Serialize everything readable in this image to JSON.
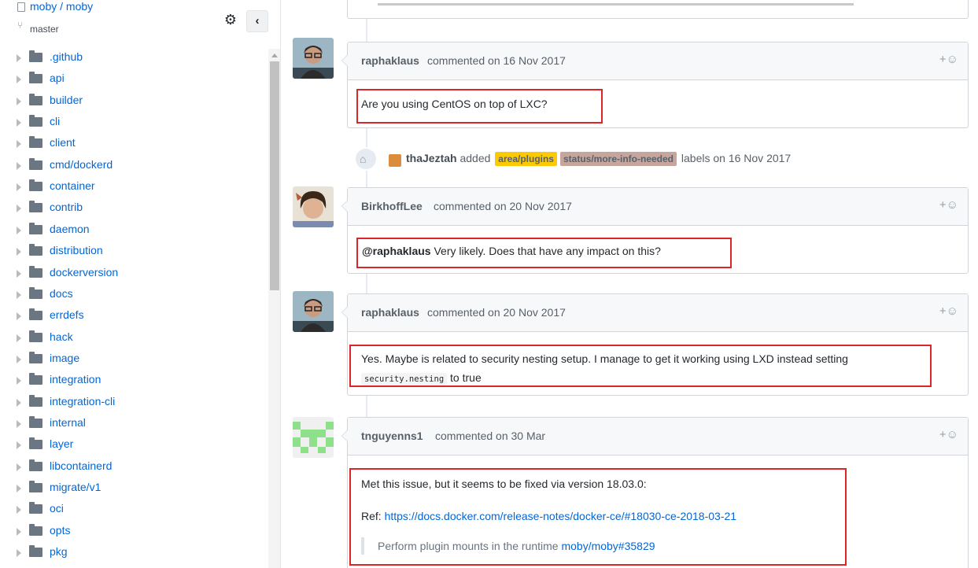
{
  "repo": {
    "name": "moby / moby",
    "branch": "master"
  },
  "sidebar": {
    "items": [
      {
        "label": ".github"
      },
      {
        "label": "api"
      },
      {
        "label": "builder"
      },
      {
        "label": "cli"
      },
      {
        "label": "client"
      },
      {
        "label": "cmd/dockerd"
      },
      {
        "label": "container"
      },
      {
        "label": "contrib"
      },
      {
        "label": "daemon"
      },
      {
        "label": "distribution"
      },
      {
        "label": "dockerversion"
      },
      {
        "label": "docs"
      },
      {
        "label": "errdefs"
      },
      {
        "label": "hack"
      },
      {
        "label": "image"
      },
      {
        "label": "integration"
      },
      {
        "label": "integration-cli"
      },
      {
        "label": "internal"
      },
      {
        "label": "layer"
      },
      {
        "label": "libcontainerd"
      },
      {
        "label": "migrate/v1"
      },
      {
        "label": "oci"
      },
      {
        "label": "opts"
      },
      {
        "label": "pkg"
      }
    ]
  },
  "comments": [
    {
      "author": "raphaklaus",
      "meta": "commented on 16 Nov 2017",
      "body": "Are you using CentOS on top of LXC?"
    },
    {
      "author": "BirkhoffLee",
      "meta": "commented on 20 Nov 2017",
      "mention": "@raphaklaus",
      "body": " Very likely. Does that have any impact on this?"
    },
    {
      "author": "raphaklaus",
      "meta": "commented on 20 Nov 2017",
      "line1": "Yes. Maybe is related to security nesting setup. I manage to get it working using LXD instead setting",
      "code": "security.nesting",
      "line2": " to true"
    },
    {
      "author": "tnguyenns1",
      "meta": "commented on 30 Mar",
      "line1": "Met this issue, but it seems to be fixed via version 18.03.0:",
      "ref_label": "Ref: ",
      "ref_link": "https://docs.docker.com/release-notes/docker-ce/#18030-ce-2018-03-21",
      "quote_text": "Perform plugin mounts in the runtime ",
      "quote_link": "moby/moby#35829"
    }
  ],
  "event": {
    "actor": "thaJeztah",
    "action": " added ",
    "labels": [
      {
        "name": "area/plugins",
        "color": "#fbca04",
        "text_color": "#24292e"
      },
      {
        "name": "status/more-info-needed",
        "color": "#c5a59c",
        "text_color": "#24292e"
      }
    ],
    "suffix": " labels on 16 Nov 2017"
  },
  "icons": {
    "reaction": "add-reaction-icon",
    "settings": "gear-icon",
    "collapse": "chevron-left-icon"
  }
}
